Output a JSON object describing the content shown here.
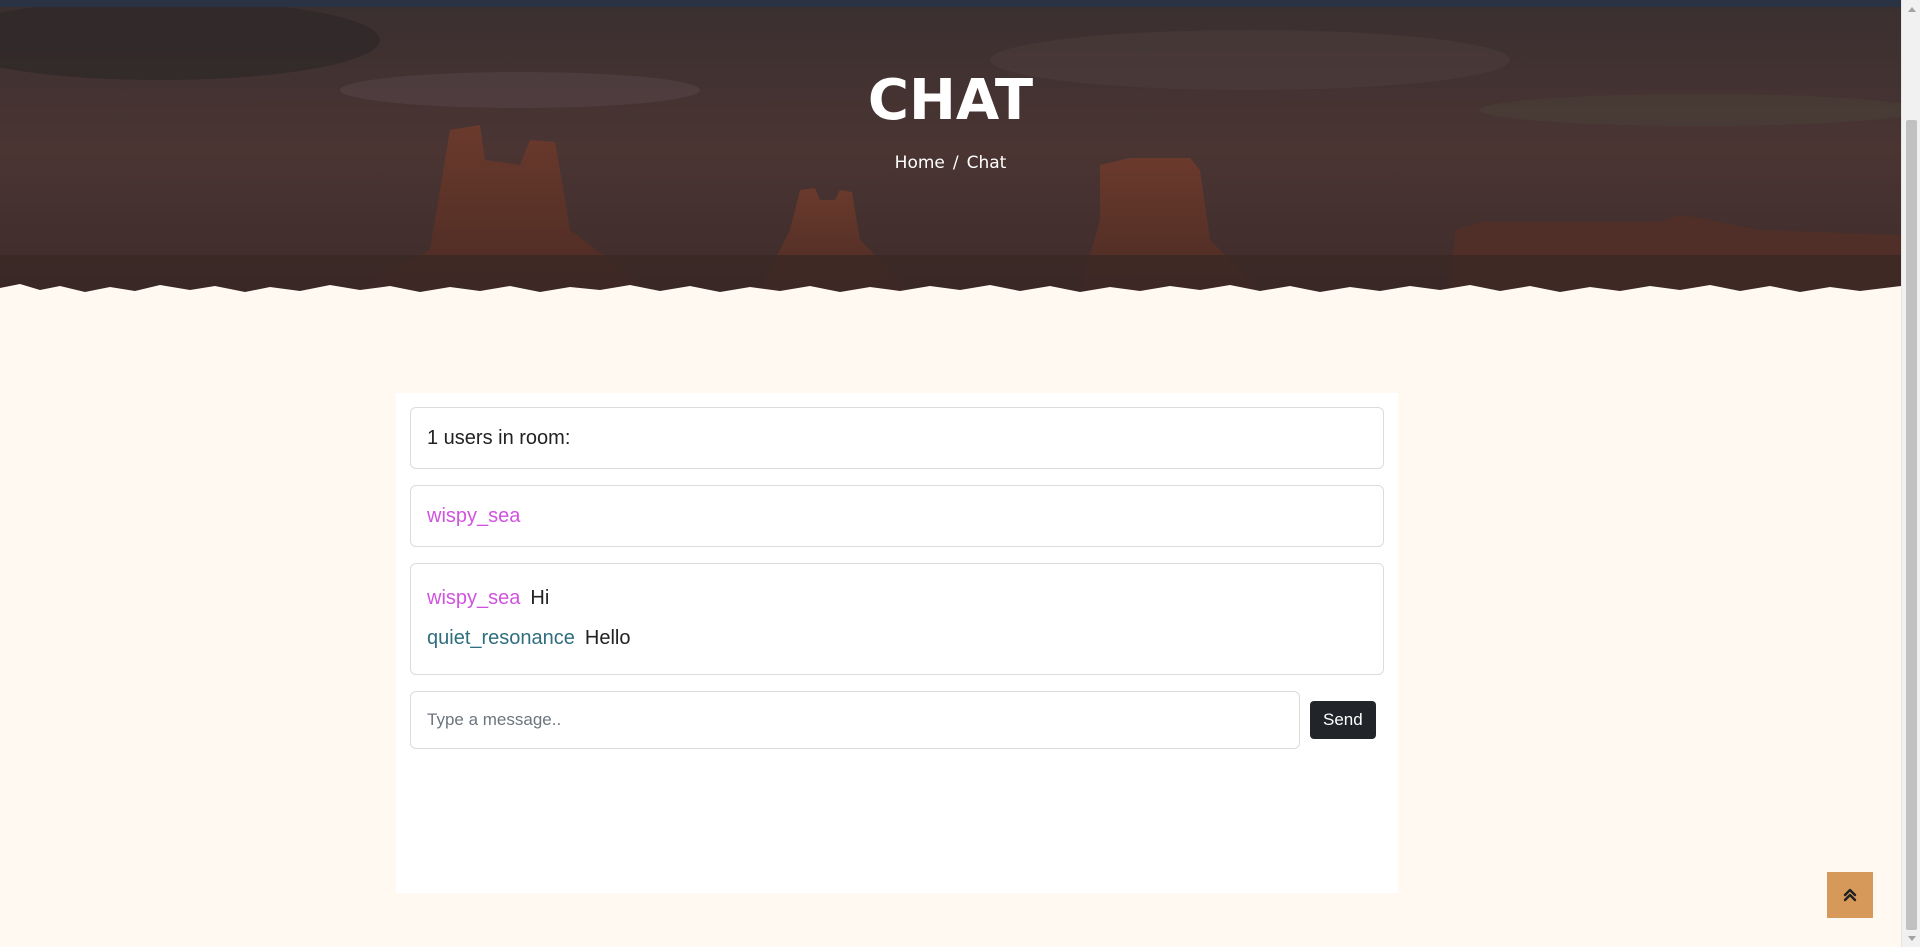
{
  "header": {
    "title": "CHAT",
    "breadcrumb": {
      "home": "Home",
      "separator": "/",
      "current": "Chat"
    }
  },
  "chat": {
    "users_count_text": "1 users in room:",
    "users": [
      {
        "name": "wispy_sea",
        "color": "#d053e0"
      }
    ],
    "messages": [
      {
        "author": "wispy_sea",
        "text": "Hi",
        "color": "#d053e0"
      },
      {
        "author": "quiet_resonance",
        "text": "Hello",
        "color": "#2e6e7e"
      }
    ],
    "input": {
      "value": "",
      "placeholder": "Type a message.."
    },
    "send_label": "Send"
  },
  "back_to_top": {
    "icon": "double-chevron-up-icon",
    "color": "#d6995a"
  },
  "colors": {
    "page_background": "#fff9f2",
    "hero_overlay": "#3b2c2c",
    "send_button": "#212529"
  }
}
